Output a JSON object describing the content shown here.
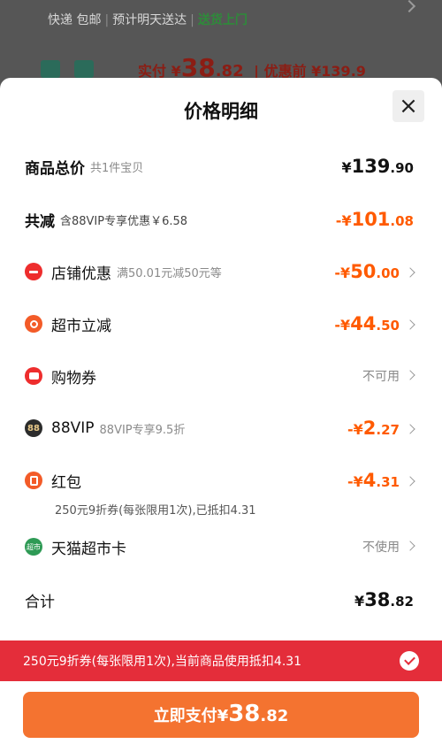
{
  "background": {
    "shipping": "快递 包邮",
    "delivery": "预计明天送达",
    "pickup": "送货上门",
    "paid_label": "实付",
    "paid_currency": "¥",
    "paid_int": "38",
    "paid_dec": ".82",
    "original_price": "| 优惠前 ¥139.9"
  },
  "sheet": {
    "title": "价格明细",
    "close_label": "×"
  },
  "rows": {
    "total": {
      "label": "商品总价",
      "sub": "共1件宝贝",
      "cur": "¥",
      "int": "139",
      "dec": ".90"
    },
    "reduce": {
      "label": "共减",
      "sub": "含88VIP专享优惠￥6.58",
      "cur": "-¥",
      "int": "101",
      "dec": ".08"
    },
    "shop": {
      "label": "店铺优惠",
      "sub": "满50.01元减50元等",
      "cur": "-¥",
      "int": "50",
      "dec": ".00"
    },
    "market": {
      "label": "超市立减",
      "cur": "-¥",
      "int": "44",
      "dec": ".50"
    },
    "coupon": {
      "label": "购物券",
      "value": "不可用"
    },
    "vip": {
      "label": "88VIP",
      "icon_text": "88",
      "sub": "88VIP专享9.5折",
      "cur": "-¥",
      "int": "2",
      "dec": ".27"
    },
    "redpacket": {
      "label": "红包",
      "cur": "-¥",
      "int": "4",
      "dec": ".31",
      "note": "250元9折券(每张限用1次),已抵扣4.31"
    },
    "card": {
      "label": "天猫超市卡",
      "icon_text": "超市",
      "value": "不使用"
    },
    "sum": {
      "label": "合计",
      "cur": "¥",
      "int": "38",
      "dec": ".82"
    }
  },
  "banner": {
    "text": "250元9折券(每张限用1次),当前商品使用抵扣4.31"
  },
  "pay_button": {
    "label": "立即支付",
    "cur": "¥",
    "int": "38",
    "dec": ".82"
  },
  "colors": {
    "accent_orange": "#f47330",
    "discount_orange": "#ff5a00",
    "banner_red": "#e42d3a",
    "green": "#2e8b3a"
  },
  "icons": {
    "shop": "store-coupon-icon",
    "market": "market-discount-icon",
    "coupon": "ticket-icon",
    "vip": "88vip-badge-icon",
    "redpacket": "red-packet-icon",
    "card": "tmall-market-card-icon"
  }
}
